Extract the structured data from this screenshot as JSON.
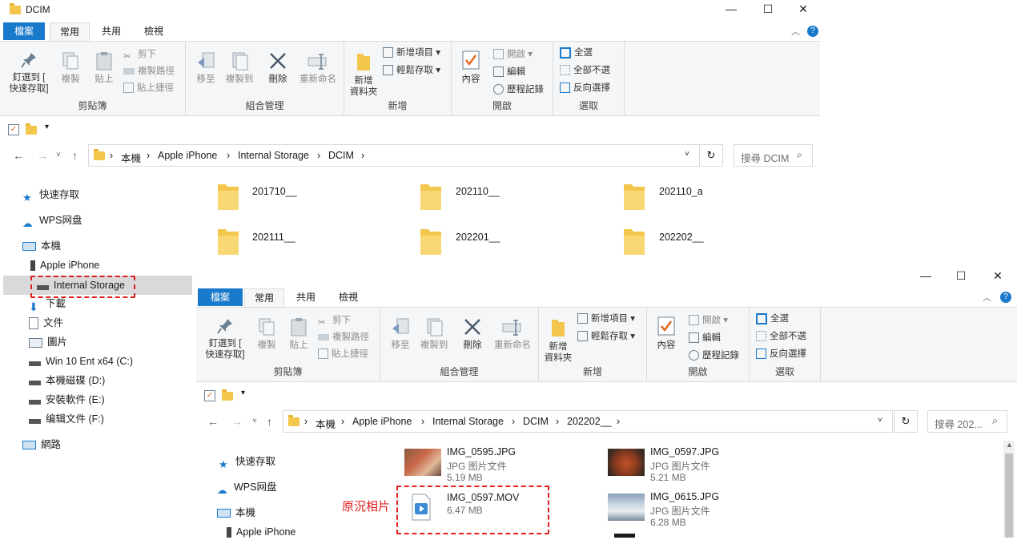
{
  "back_window": {
    "title": "DCIM",
    "tabs": [
      "檔案",
      "常用",
      "共用",
      "檢視"
    ],
    "ribbon": {
      "clipboard": {
        "label": "剪貼簿",
        "pin": "釘選到 [\n快速存取]",
        "copy": "複製",
        "paste": "貼上",
        "cut": "剪下",
        "copy_path": "複製路徑",
        "paste_shortcut": "貼上捷徑"
      },
      "organize": {
        "label": "組合管理",
        "move_to": "移至",
        "copy_to": "複製到",
        "delete": "刪除",
        "rename": "重新命名"
      },
      "new": {
        "label": "新增",
        "new_folder": "新增\n資料夾",
        "new_item": "新增項目",
        "easy_access": "輕鬆存取"
      },
      "open": {
        "label": "開啟",
        "properties": "內容",
        "open": "開啟",
        "edit": "編輯",
        "history": "歷程記錄"
      },
      "select": {
        "label": "選取",
        "select_all": "全選",
        "select_none": "全部不選",
        "invert": "反向選擇"
      }
    },
    "breadcrumb": [
      "本機",
      "Apple iPhone",
      "Internal Storage",
      "DCIM"
    ],
    "search_placeholder": "搜尋 DCIM",
    "nav": [
      {
        "label": "快速存取",
        "icon": "star-icon"
      },
      {
        "label": "WPS网盘",
        "icon": "cloud-icon"
      },
      {
        "label": "本機",
        "icon": "computer-icon"
      },
      {
        "label": "Apple iPhone",
        "icon": "phone-icon"
      },
      {
        "label": "Internal Storage",
        "icon": "drive-icon"
      },
      {
        "label": "下載",
        "icon": "download-icon"
      },
      {
        "label": "文件",
        "icon": "document-icon"
      },
      {
        "label": "圖片",
        "icon": "pictures-icon"
      },
      {
        "label": "Win 10 Ent x64 (C:)",
        "icon": "drive-icon"
      },
      {
        "label": "本機磁碟 (D:)",
        "icon": "drive-icon"
      },
      {
        "label": "安裝軟件 (E:)",
        "icon": "drive-icon"
      },
      {
        "label": "编辑文件 (F:)",
        "icon": "drive-icon"
      },
      {
        "label": "網路",
        "icon": "network-icon"
      }
    ],
    "folders": [
      "201710__",
      "202110__",
      "202110_a",
      "202111__",
      "202201__",
      "202202__"
    ]
  },
  "front_window": {
    "tabs": [
      "檔案",
      "常用",
      "共用",
      "檢視"
    ],
    "ribbon": {
      "clipboard": {
        "label": "剪貼簿",
        "pin": "釘選到 [\n快速存取]",
        "copy": "複製",
        "paste": "貼上",
        "cut": "剪下",
        "copy_path": "複製路徑",
        "paste_shortcut": "貼上捷徑"
      },
      "organize": {
        "label": "組合管理",
        "move_to": "移至",
        "copy_to": "複製到",
        "delete": "刪除",
        "rename": "重新命名"
      },
      "new": {
        "label": "新增",
        "new_folder": "新增\n資料夾",
        "new_item": "新增項目",
        "easy_access": "輕鬆存取"
      },
      "open": {
        "label": "開啟",
        "properties": "內容",
        "open": "開啟",
        "edit": "編輯",
        "history": "歷程記錄"
      },
      "select": {
        "label": "選取",
        "select_all": "全選",
        "select_none": "全部不選",
        "invert": "反向選擇"
      }
    },
    "breadcrumb": [
      "本機",
      "Apple iPhone",
      "Internal Storage",
      "DCIM",
      "202202__"
    ],
    "search_placeholder": "搜尋 202...",
    "nav": [
      {
        "label": "快速存取",
        "icon": "star-icon"
      },
      {
        "label": "WPS网盘",
        "icon": "cloud-icon"
      },
      {
        "label": "本機",
        "icon": "computer-icon"
      },
      {
        "label": "Apple iPhone",
        "icon": "phone-icon"
      }
    ],
    "files": [
      {
        "name": "IMG_0595.JPG",
        "type": "JPG 图片文件",
        "size": "5.19 MB"
      },
      {
        "name": "IMG_0597.JPG",
        "type": "JPG 图片文件",
        "size": "5.21 MB"
      },
      {
        "name": "IMG_0597.MOV",
        "type": "",
        "size": "6.47 MB"
      },
      {
        "name": "IMG_0615.JPG",
        "type": "JPG 图片文件",
        "size": "6.28 MB"
      }
    ],
    "annotation": "原況相片"
  },
  "colors": {
    "file_tab": "#1979ca",
    "highlight": "#e01e1e",
    "folder": "#f3c74c",
    "selected_bg": "#d9d9d9"
  }
}
